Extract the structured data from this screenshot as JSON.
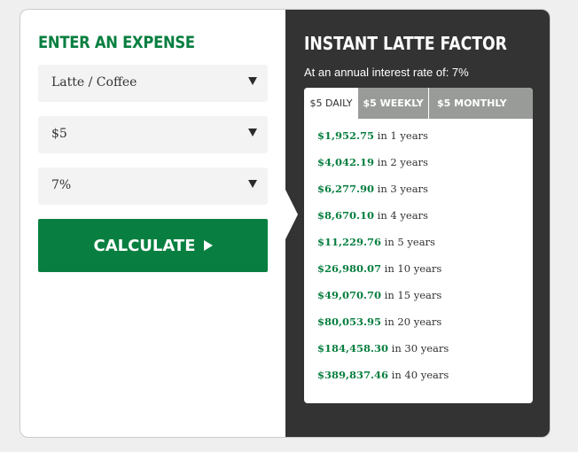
{
  "form": {
    "title": "ENTER AN EXPENSE",
    "expense": "Latte / Coffee",
    "amount": "$5",
    "rate": "7%",
    "calculate_label": "CALCULATE"
  },
  "results": {
    "title": "INSTANT LATTE FACTOR",
    "rate_text": "At an annual interest rate of: 7%",
    "tabs": [
      {
        "label": "$5 DAILY",
        "active": true
      },
      {
        "label": "$5 WEEKLY",
        "active": false
      },
      {
        "label": "$5 MONTHLY",
        "active": false
      }
    ],
    "items": [
      {
        "amount": "$1,952.75",
        "text": " in 1 years"
      },
      {
        "amount": "$4,042.19",
        "text": " in 2 years"
      },
      {
        "amount": "$6,277.90",
        "text": " in 3 years"
      },
      {
        "amount": "$8,670.10",
        "text": " in 4 years"
      },
      {
        "amount": "$11,229.76",
        "text": " in 5 years"
      },
      {
        "amount": "$26,980.07",
        "text": " in 10 years"
      },
      {
        "amount": "$49,070.70",
        "text": " in 15 years"
      },
      {
        "amount": "$80,053.95",
        "text": " in 20 years"
      },
      {
        "amount": "$184,458.30",
        "text": " in 30 years"
      },
      {
        "amount": "$389,837.46",
        "text": " in 40 years"
      }
    ]
  },
  "colors": {
    "accent": "#087f40",
    "panel": "#333333",
    "tab_inactive": "#999b99"
  }
}
